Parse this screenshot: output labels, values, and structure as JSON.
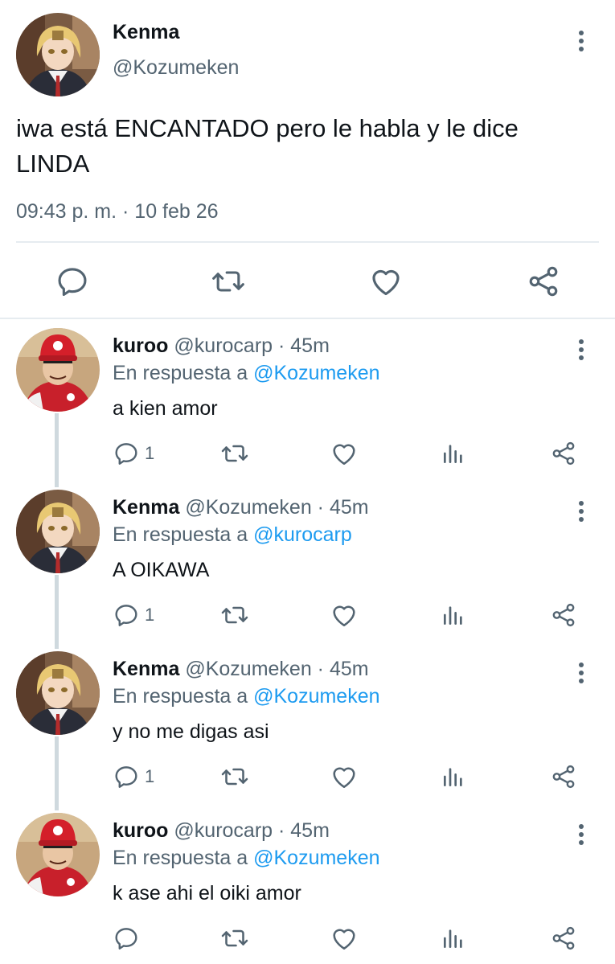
{
  "main_tweet": {
    "name": "Kenma",
    "handle": "@Kozumeken",
    "text": "iwa está ENCANTADO pero le habla y le dice LINDA",
    "timestamp": "09:43 p. m. · 10 feb 26",
    "actions": [
      "reply-icon",
      "retweet-icon",
      "like-icon",
      "share-icon"
    ]
  },
  "replies": [
    {
      "name": "kuroo",
      "meta": "@kurocarp · 45m",
      "in_reply_label": "En respuesta a ",
      "in_reply_handle": "@Kozumeken",
      "text": "a kien amor",
      "reply_count": "1",
      "avatar": "kuroo"
    },
    {
      "name": "Kenma",
      "meta": "@Kozumeken · 45m",
      "in_reply_label": "En respuesta a ",
      "in_reply_handle": "@kurocarp",
      "text": "A OIKAWA",
      "reply_count": "1",
      "avatar": "kenma"
    },
    {
      "name": "Kenma",
      "meta": "@Kozumeken · 45m",
      "in_reply_label": "En respuesta a ",
      "in_reply_handle": "@Kozumeken",
      "text": "y no me digas asi",
      "reply_count": "1",
      "avatar": "kenma"
    },
    {
      "name": "kuroo",
      "meta": "@kurocarp · 45m",
      "in_reply_label": "En respuesta a ",
      "in_reply_handle": "@Kozumeken",
      "text": "k ase ahi el oiki amor",
      "reply_count": "",
      "avatar": "kuroo"
    }
  ],
  "colors": {
    "text": "#0f1419",
    "secondary": "#536471",
    "link": "#1d9bf0",
    "divider": "#e6ecf0",
    "thread_line": "#cfd9de"
  }
}
